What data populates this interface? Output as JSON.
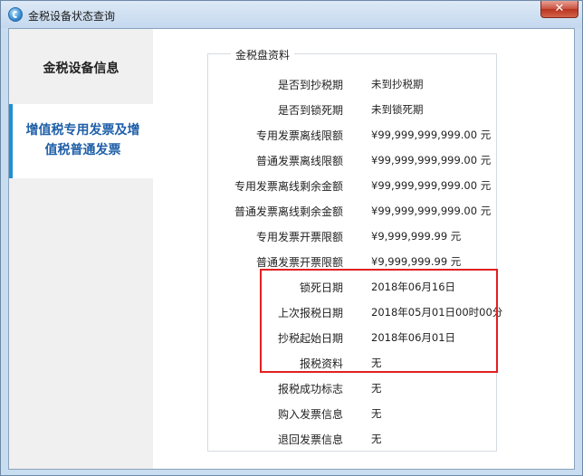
{
  "window": {
    "title": "金税设备状态查询",
    "close_symbol": "✕"
  },
  "sidebar": {
    "items": [
      {
        "label": "金税设备信息"
      },
      {
        "label_line1": "增值税专用发票及增",
        "label_line2": "值税普通发票"
      }
    ]
  },
  "group": {
    "title": "金税盘资料",
    "rows": [
      {
        "label": "是否到抄税期",
        "value": "未到抄税期"
      },
      {
        "label": "是否到锁死期",
        "value": "未到锁死期"
      },
      {
        "label": "专用发票离线限额",
        "value": "¥99,999,999,999.00 元"
      },
      {
        "label": "普通发票离线限额",
        "value": "¥99,999,999,999.00 元"
      },
      {
        "label": "专用发票离线剩余金额",
        "value": "¥99,999,999,999.00 元"
      },
      {
        "label": "普通发票离线剩余金额",
        "value": "¥99,999,999,999.00 元"
      },
      {
        "label": "专用发票开票限额",
        "value": "¥9,999,999.99 元"
      },
      {
        "label": "普通发票开票限额",
        "value": "¥9,999,999.99 元"
      },
      {
        "label": "锁死日期",
        "value": "2018年06月16日"
      },
      {
        "label": "上次报税日期",
        "value": "2018年05月01日00时00分"
      },
      {
        "label": "抄税起始日期",
        "value": "2018年06月01日"
      },
      {
        "label": "报税资料",
        "value": "无"
      },
      {
        "label": "报税成功标志",
        "value": "无"
      },
      {
        "label": "购入发票信息",
        "value": "无"
      },
      {
        "label": "退回发票信息",
        "value": "无"
      }
    ]
  },
  "colors": {
    "highlight_border": "#e02020",
    "active_tab_accent": "#1f8fd6",
    "active_tab_text": "#1f5fa8"
  }
}
